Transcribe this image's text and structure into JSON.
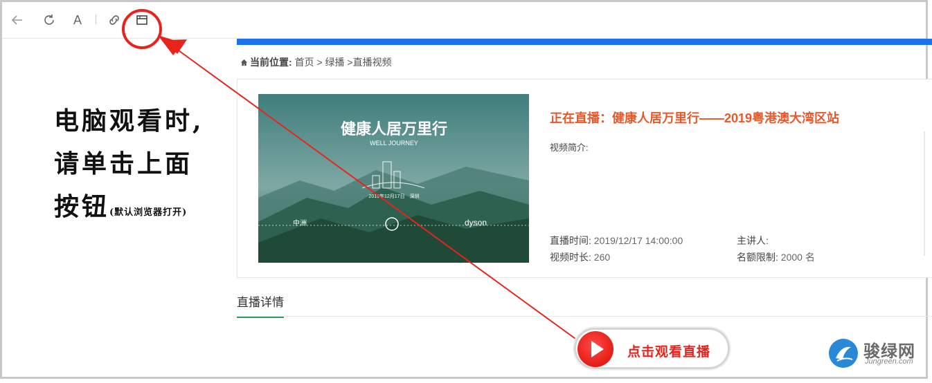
{
  "toolbar": {
    "back_icon": "back-arrow-icon",
    "refresh_icon": "refresh-icon",
    "font_icon": "font-icon",
    "font_label": "A",
    "link_icon": "link-icon",
    "browser_icon": "open-in-browser-icon"
  },
  "breadcrumb": {
    "label": "当前位置:",
    "path": "首页 > 绿播 >直播视频"
  },
  "video": {
    "title": "正在直播：健康人居万里行——2019粤港澳大湾区站",
    "intro_label": "视频简介:",
    "poster": {
      "headline": "健康人居万里行",
      "subline": "WELL JOURNEY",
      "date_place": "2019年12月17日　深圳",
      "brand_left": "中洲",
      "brand_right": "dyson"
    },
    "live_time_label": "直播时间:",
    "live_time": "2019/12/17 14:00:00",
    "duration_label": "视频时长:",
    "duration": "260",
    "speaker_label": "主讲人:",
    "speaker": "",
    "quota_label": "名额限制:",
    "quota": "2000 名"
  },
  "tabs": [
    {
      "label": "直播详情",
      "active": true
    }
  ],
  "instruction": {
    "line1": "电脑观看时,",
    "line2": "请单击上面",
    "line3": "按钮",
    "line3_small": "(默认浏览器打开)"
  },
  "watch_button": {
    "label": "点击观看直播",
    "icon": "play-icon"
  },
  "logo": {
    "name": "骏绿网",
    "sub": "Jungreen.com"
  },
  "colors": {
    "accent_blue": "#1a73e8",
    "title_orange": "#e8582a",
    "annotation_red": "#e8231b",
    "tab_green": "#2aa15b"
  }
}
